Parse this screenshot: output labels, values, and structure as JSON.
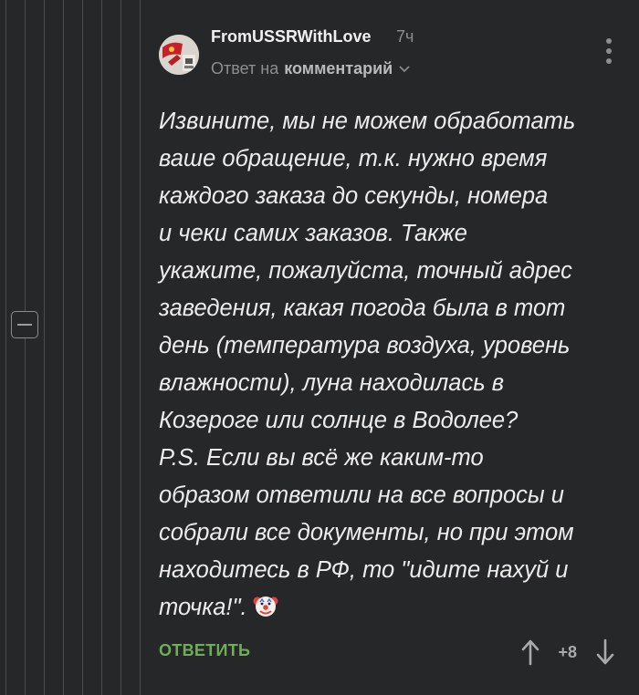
{
  "comment": {
    "author": "FromUSSRWithLove",
    "time": "7ч",
    "reply_prefix": "Ответ на",
    "reply_link": "комментарий",
    "text": "Извините, мы не можем обработать\nваше обращение, т.к. нужно время\nкаждого заказа до секунды, номера\nи чеки самих заказов. Также\nукажите, пожалуйста, точный адрес\nзаведения, какая погода была в тот\nдень (температура воздуха, уровень\nвлажности), луна находилась в\nКозероге или солнце в Водолее?\nP.S. Если вы всё же каким-то\nобразом ответили на все вопросы и\nсобрали все документы, но при этом\nнаходитесь в РФ, то \"идите нахуй и\nточка!\".",
    "reply_label": "ОТВЕТИТЬ",
    "rating": "+8"
  },
  "icons": {
    "collapse": "minus-square-icon",
    "more": "vertical-dots-icon",
    "chevron": "chevron-down-icon",
    "upvote": "arrow-up-icon",
    "downvote": "arrow-down-icon",
    "emoji": "clown-face-icon"
  },
  "colors": {
    "background": "#262729",
    "accent_green": "#6fae57",
    "muted": "#8d8e90"
  }
}
